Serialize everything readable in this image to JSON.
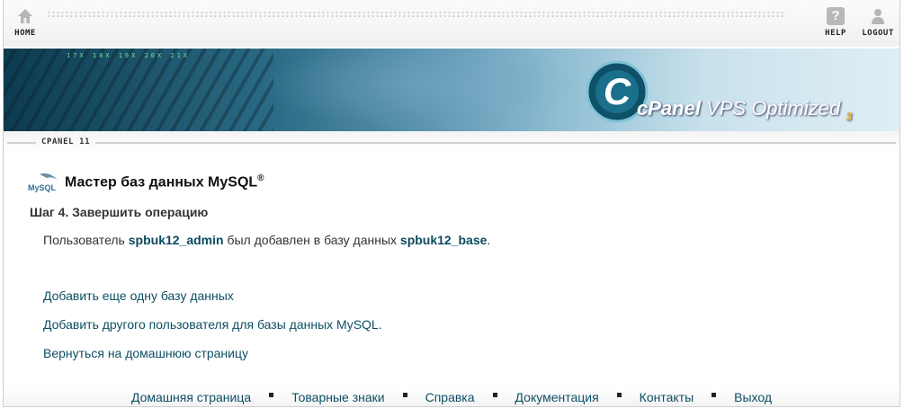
{
  "nav": {
    "home_label": "HOME",
    "help_label": "HELP",
    "logout_label": "LOGOUT",
    "help_icon_glyph": "?"
  },
  "banner": {
    "logo_letter": "C",
    "brand": "cPanel",
    "product": "VPS Optimized",
    "version": "3",
    "digits": "17X  18X  19X  20X  21X"
  },
  "section": {
    "tag": "CPANEL 11"
  },
  "content": {
    "title": "Мастер баз данных MySQL",
    "title_mark": "®",
    "mysql_logo_text": "MySQL",
    "step": "Шаг 4. Завершить операцию",
    "msg_prefix": "Пользователь ",
    "user": "spbuk12_admin",
    "msg_middle": " был добавлен в базу данных ",
    "database": "spbuk12_base",
    "msg_suffix": ".",
    "links": [
      "Добавить еще одну базу данных",
      "Добавить другого пользователя для базы данных MySQL.",
      "Вернуться на домашнюю страницу"
    ]
  },
  "footer": {
    "links": [
      "Домашняя страница",
      "Товарные знаки",
      "Справка",
      "Документация",
      "Контакты",
      "Выход"
    ]
  },
  "colors": {
    "link": "#0d4f63",
    "banner_dark": "#0d3b4f",
    "banner_light": "#dfeef5"
  }
}
